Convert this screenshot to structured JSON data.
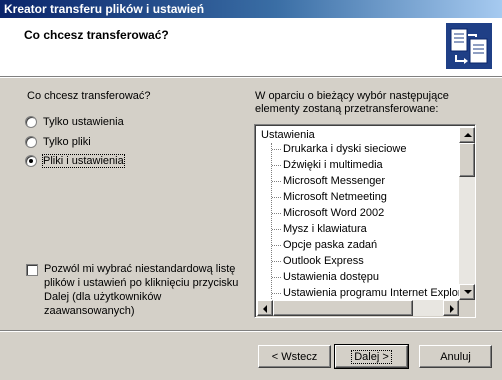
{
  "window": {
    "title": "Kreator transferu plików i ustawień"
  },
  "header": {
    "title": "Co chcesz transferować?",
    "icon": "wizard-transfer-icon"
  },
  "left": {
    "question": "Co chcesz transferować?",
    "options": [
      {
        "label": "Tylko ustawienia",
        "selected": false
      },
      {
        "label": "Tylko pliki",
        "selected": false
      },
      {
        "label": "Pliki i ustawienia",
        "selected": true
      }
    ],
    "custom_checkbox": {
      "label": "Pozwól mi wybrać niestandardową listę plików i ustawień po kliknięciu przycisku Dalej (dla użytkowników zaawansowanych)",
      "checked": false
    }
  },
  "right": {
    "description": "W oparciu o bieżący wybór następujące elementy zostaną przetransferowane:",
    "tree_root": "Ustawienia",
    "tree_items": [
      "Drukarka i dyski sieciowe",
      "Dźwięki i multimedia",
      "Microsoft Messenger",
      "Microsoft Netmeeting",
      "Microsoft Word 2002",
      "Mysz i klawiatura",
      "Opcje paska zadań",
      "Outlook Express",
      "Ustawienia dostępu",
      "Ustawienia programu Internet Explorer"
    ]
  },
  "buttons": {
    "back": "< Wstecz",
    "next": "Dalej >",
    "cancel": "Anuluj"
  },
  "colors": {
    "titlebar_start": "#0a246a",
    "titlebar_end": "#a6caf0",
    "face": "#d4d0c8"
  }
}
